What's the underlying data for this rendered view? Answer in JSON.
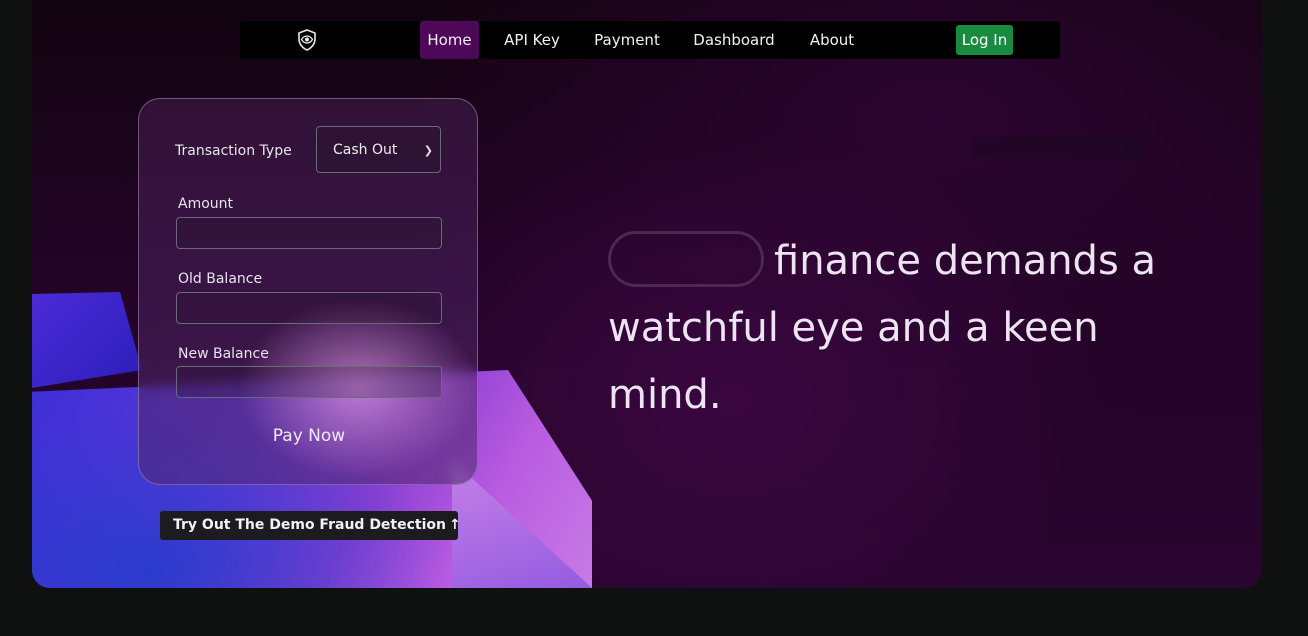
{
  "nav": {
    "logo_icon": "shield-eye-icon",
    "items": [
      "Home",
      "API Key",
      "Payment",
      "Dashboard",
      "About"
    ],
    "active": "Home",
    "login_label": "Log In"
  },
  "form": {
    "transaction_type_label": "Transaction Type",
    "transaction_type_value": "Cash Out",
    "amount_label": "Amount",
    "amount_value": "",
    "old_balance_label": "Old Balance",
    "old_balance_value": "",
    "new_balance_label": "New Balance",
    "new_balance_value": "",
    "submit_label": "Pay Now"
  },
  "demo": {
    "label": "Try Out The Demo Fraud Detection",
    "icon": "arrow-up-icon"
  },
  "hero": {
    "line1": "finance demands a",
    "line2": "watchful eye and a keen mind."
  },
  "colors": {
    "nav_active": "#4d0857",
    "login_bg": "#1a8b3e",
    "page_bg": "#0f1110"
  }
}
